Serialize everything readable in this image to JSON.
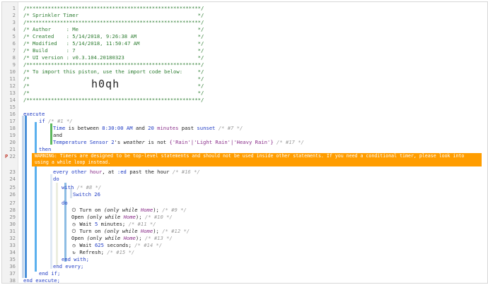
{
  "header_comments": [
    "/*********************************************************/",
    "/* Sprinkler Timer                                       */",
    "/*********************************************************/",
    "/* Author     : Me                                       */",
    "/* Created    : 5/14/2018, 9:26:38 AM                    */",
    "/* Modified   : 5/14/2018, 11:50:47 AM                   */",
    "/* Build      : 7                                        */",
    "/* UI version : v0.3.104.20180323                        */",
    "/*********************************************************/",
    "/* To import this piston, use the import code below:     */",
    "/*                                                       */",
    "/*                                                       */",
    "/*                                                       */",
    "/*********************************************************/"
  ],
  "import_code": "h0qh",
  "line_numbers": [
    "1",
    "2",
    "3",
    "4",
    "5",
    "6",
    "7",
    "8",
    "9",
    "10",
    "11",
    "12",
    "13",
    "14",
    "15",
    "16",
    "17",
    "18",
    "19",
    "20",
    "21",
    "22",
    "23",
    "24",
    "25",
    "26",
    "27",
    "28",
    "29",
    "30",
    "31",
    "32",
    "33",
    "34",
    "35",
    "36",
    "37",
    "38"
  ],
  "warning_marker": "P",
  "code": {
    "execute": "execute",
    "if": "if",
    "c1": "/* #1 */",
    "cond1_a": "Time",
    "cond1_b": " is between ",
    "cond1_c": "8:30:00 AM",
    "cond1_d": " and ",
    "cond1_e": "20",
    "cond1_f": " minutes",
    "cond1_g": " past ",
    "cond1_h": "sunset",
    "c7": "/* #7 */",
    "and": "and",
    "cond2_a": "Temperature Sensor 2",
    "cond2_b": "'s ",
    "cond2_c": "weather",
    "cond2_d": " is not ",
    "cond2_e": "{'Rain'|'Light Rain'|'Heavy Rain'}",
    "c17": "/* #17 */",
    "then": "then",
    "warning": "WARNING: Timers are designed to be top-level statements and should not be used inside other statements. If you need a conditional timer, please look into using a while loop instead.",
    "every_a": "every other ",
    "every_b": "hour",
    "every_c": ", at ",
    "every_d": ":ed",
    "every_e": " past the hour ",
    "c16": "/* #16 */",
    "do1": "do",
    "with": "with",
    "c8": "/* #8 */",
    "switch": "Switch 26",
    "do2": "do",
    "s1_a": "Turn on",
    "s1_b": " (only while ",
    "s1_c": "Home",
    "s1_d": ");",
    "c9": "/* #9 */",
    "s2_a": "Open",
    "c10": "/* #10 */",
    "s3_a": "Wait ",
    "s3_b": "5",
    "s3_c": " minutes;",
    "c11": "/* #11 */",
    "c12": "/* #12 */",
    "c13": "/* #13 */",
    "s6_b": "625",
    "s6_c": " seconds;",
    "c14": "/* #14 */",
    "s7_a": "Refresh;",
    "c15": "/* #15 */",
    "end_with": "end with;",
    "end_every": "end every;",
    "end_if": "end if;",
    "end_execute": "end execute;"
  },
  "icons": {
    "power": "power-icon",
    "clock": "clock-icon",
    "refresh": "refresh-icon"
  },
  "colors": {
    "warning": "#ff9d00",
    "comment": "#2e7d32",
    "keyword": "#1f3bc4"
  }
}
